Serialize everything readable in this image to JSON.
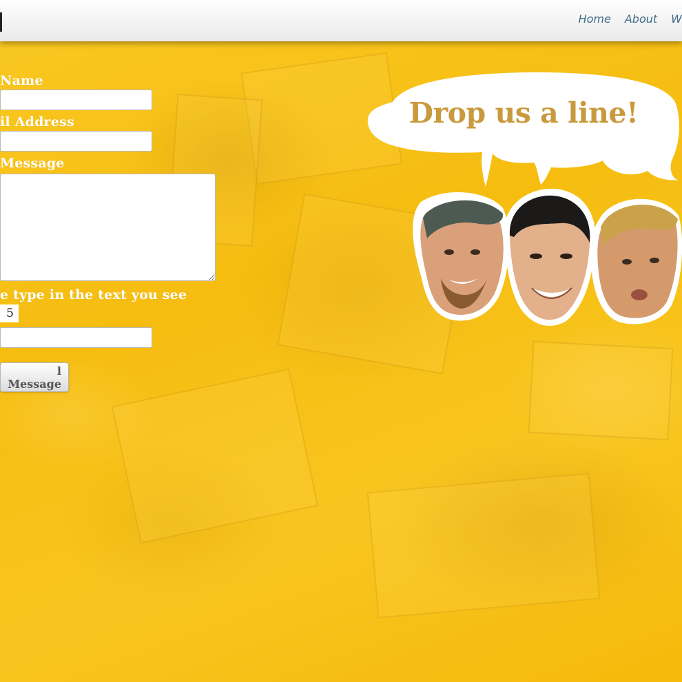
{
  "nav": {
    "items": [
      "Home",
      "About",
      "W"
    ]
  },
  "form": {
    "name_label": "Name",
    "email_label": "il Address",
    "message_label": "Message",
    "captcha_label": "e type in the text you see",
    "captcha_text": "5",
    "submit_label": "l Message",
    "name_value": "",
    "email_value": "",
    "message_value": "",
    "captcha_value": ""
  },
  "bubble": {
    "text": "Drop us a line!"
  },
  "faces": [
    "face-1",
    "face-2",
    "face-3"
  ],
  "colors": {
    "background": "#f7c21a",
    "nav_link": "#3f6b8a",
    "bubble_text": "#c99a3d",
    "label_text": "#ffffff"
  }
}
